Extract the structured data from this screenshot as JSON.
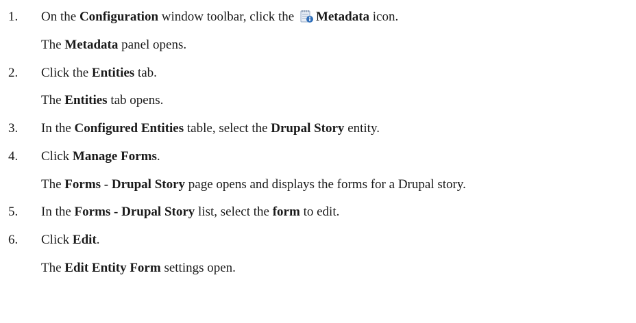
{
  "steps": [
    {
      "number": "1.",
      "action": {
        "t1": "On the ",
        "b1": "Configuration",
        "t2": " window toolbar, click the ",
        "icon": "metadata-icon",
        "b2": "Metadata",
        "t3": " icon."
      },
      "result": {
        "t1": "The ",
        "b1": "Metadata",
        "t2": " panel opens."
      }
    },
    {
      "number": "2.",
      "action": {
        "t1": "Click the ",
        "b1": "Entities",
        "t2": " tab."
      },
      "result": {
        "t1": "The ",
        "b1": "Entities",
        "t2": " tab opens."
      }
    },
    {
      "number": "3.",
      "action": {
        "t1": "In the ",
        "b1": "Configured Entities",
        "t2": " table, select the ",
        "b2": "Drupal Story",
        "t3": " entity."
      }
    },
    {
      "number": "4.",
      "action": {
        "t1": "Click ",
        "b1": "Manage Forms",
        "t2": "."
      },
      "result": {
        "t1": "The ",
        "b1": "Forms - Drupal Story",
        "t2": " page opens and displays the forms for a Drupal story."
      }
    },
    {
      "number": "5.",
      "action": {
        "t1": "In the ",
        "b1": "Forms - Drupal Story",
        "t2": " list, select the ",
        "b2": "form",
        "t3": " to edit."
      }
    },
    {
      "number": "6.",
      "action": {
        "t1": "Click ",
        "b1": "Edit",
        "t2": "."
      },
      "result": {
        "t1": "The ",
        "b1": "Edit Entity Form",
        "t2": " settings open."
      }
    }
  ],
  "colors": {
    "text": "#1a1a1a",
    "icon_page": "#dfe9f5",
    "icon_badge": "#2f6fba"
  }
}
